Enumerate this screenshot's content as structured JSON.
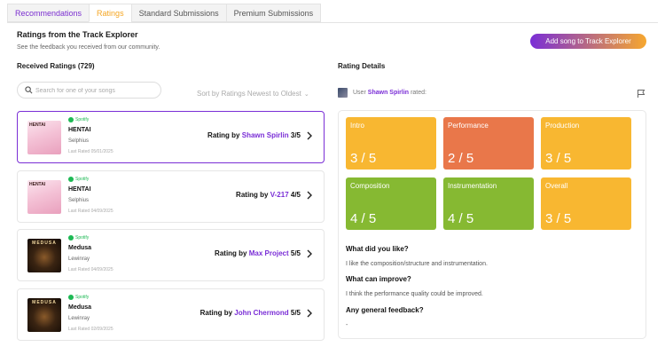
{
  "tabs": [
    "Recommendations",
    "Ratings",
    "Standard Submissions",
    "Premium Submissions"
  ],
  "header": {
    "title": "Ratings from the Track Explorer",
    "subtitle": "See the feedback you received from our community.",
    "add_button": "Add song to Track Explorer"
  },
  "received": {
    "title": "Received Ratings (729)",
    "search_placeholder": "Search for one of your songs",
    "sort_label": "Sort by Ratings Newest to Oldest"
  },
  "ratings": [
    {
      "platform": "Spotify",
      "song": "HENTAI",
      "artist": "Selphius",
      "date": "Last Rated 05/01/2025",
      "prefix": "Rating by",
      "rater": "Shawn Spirlin",
      "score": "3/5",
      "art_text": "HENTAI",
      "thumb_color": "#f4c2d6"
    },
    {
      "platform": "Spotify",
      "song": "HENTAI",
      "artist": "Selphius",
      "date": "Last Rated 04/09/2025",
      "prefix": "Rating by",
      "rater": "V-217",
      "score": "4/5",
      "art_text": "HENTAI",
      "thumb_color": "#f4c2d6"
    },
    {
      "platform": "Spotify",
      "song": "Medusa",
      "artist": "Lewinray",
      "date": "Last Rated 04/09/2025",
      "prefix": "Rating by",
      "rater": "Max Project",
      "score": "5/5",
      "art_text": "MEDUSA",
      "thumb_color": "#3a2412"
    },
    {
      "platform": "Spotify",
      "song": "Medusa",
      "artist": "Lewinray",
      "date": "Last Rated 02/09/2025",
      "prefix": "Rating by",
      "rater": "John Chermond",
      "score": "5/5",
      "art_text": "MEDUSA",
      "thumb_color": "#3a2412"
    }
  ],
  "detail": {
    "title": "Rating Details",
    "user_prefix": "User",
    "user_name": "Shawn Spirlin",
    "user_suffix": "rated:",
    "tiles": [
      {
        "label": "Intro",
        "score": "3 / 5",
        "color": "#f8b731"
      },
      {
        "label": "Performance",
        "score": "2 / 5",
        "color": "#e9774a"
      },
      {
        "label": "Production",
        "score": "3 / 5",
        "color": "#f8b731"
      },
      {
        "label": "Composition",
        "score": "4 / 5",
        "color": "#86b932"
      },
      {
        "label": "Instrumentation",
        "score": "4 / 5",
        "color": "#86b932"
      },
      {
        "label": "Overall",
        "score": "3 / 5",
        "color": "#f8b731"
      }
    ],
    "q_like": "What did you like?",
    "a_like": "I like the composition/structure and instrumentation.",
    "q_improve": "What can improve?",
    "a_improve": "I think the performance quality could be improved.",
    "q_general": "Any general feedback?",
    "a_general": "-"
  },
  "colors": {
    "accent": "#7a2ed6",
    "orange": "#f6a72f"
  }
}
